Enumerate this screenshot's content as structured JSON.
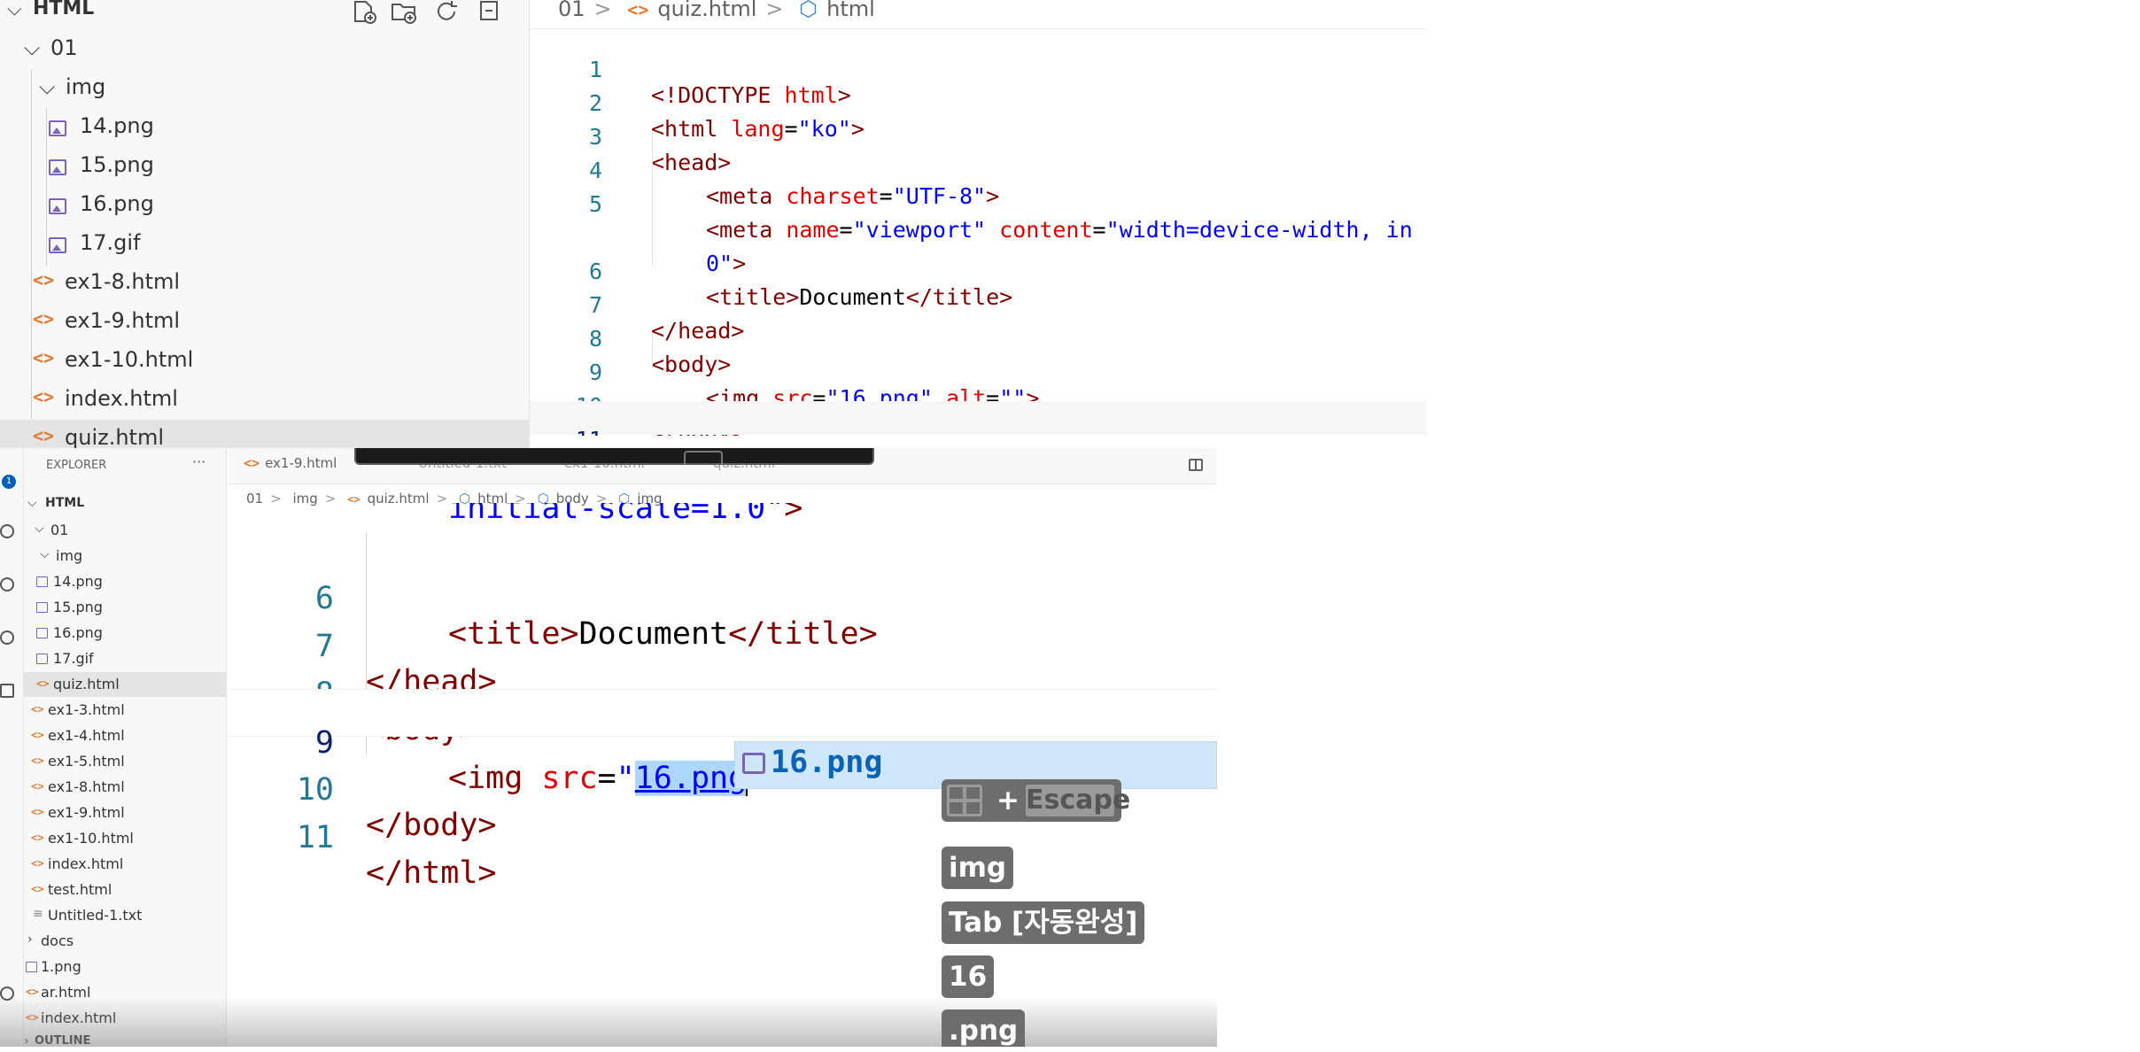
{
  "top_explorer": {
    "root_label": "HTML",
    "items": [
      {
        "label": "01",
        "type": "folder",
        "expanded": true
      },
      {
        "label": "img",
        "type": "folder",
        "expanded": true
      },
      {
        "label": "14.png",
        "type": "image"
      },
      {
        "label": "15.png",
        "type": "image"
      },
      {
        "label": "16.png",
        "type": "image"
      },
      {
        "label": "17.gif",
        "type": "image"
      },
      {
        "label": "ex1-8.html",
        "type": "html"
      },
      {
        "label": "ex1-9.html",
        "type": "html"
      },
      {
        "label": "ex1-10.html",
        "type": "html"
      },
      {
        "label": "index.html",
        "type": "html"
      },
      {
        "label": "quiz.html",
        "type": "html",
        "selected": true
      }
    ]
  },
  "top_editor": {
    "breadcrumb": [
      "01",
      "quiz.html",
      "html"
    ],
    "lines": [
      {
        "n": "1",
        "text": "<!DOCTYPE html>"
      },
      {
        "n": "2",
        "text": "<html lang=\"ko\">"
      },
      {
        "n": "3",
        "text": "<head>"
      },
      {
        "n": "4",
        "text": "<meta charset=\"UTF-8\">"
      },
      {
        "n": "5",
        "text": "<meta name=\"viewport\" content=\"width=device-width, in"
      },
      {
        "n": "",
        "text": "0\">"
      },
      {
        "n": "6",
        "text": "<title>Document</title>"
      },
      {
        "n": "7",
        "text": "</head>"
      },
      {
        "n": "8",
        "text": "<body>"
      },
      {
        "n": "9",
        "text": "<img src=\"16.png\" alt=\"\">"
      },
      {
        "n": "10",
        "text": "</body>"
      },
      {
        "n": "11",
        "text": "</html>"
      }
    ]
  },
  "bottom": {
    "explorer_title": "EXPLORER",
    "explorer_more": "···",
    "activity_badge": "1",
    "tree": [
      {
        "label": "HTML",
        "type": "root"
      },
      {
        "label": "01",
        "type": "folder"
      },
      {
        "label": "img",
        "type": "folder"
      },
      {
        "label": "14.png",
        "type": "image"
      },
      {
        "label": "15.png",
        "type": "image"
      },
      {
        "label": "16.png",
        "type": "image"
      },
      {
        "label": "17.gif",
        "type": "image"
      },
      {
        "label": "quiz.html",
        "type": "html",
        "selected": true
      },
      {
        "label": "ex1-3.html",
        "type": "html"
      },
      {
        "label": "ex1-4.html",
        "type": "html"
      },
      {
        "label": "ex1-5.html",
        "type": "html"
      },
      {
        "label": "ex1-8.html",
        "type": "html"
      },
      {
        "label": "ex1-9.html",
        "type": "html"
      },
      {
        "label": "ex1-10.html",
        "type": "html"
      },
      {
        "label": "index.html",
        "type": "html"
      },
      {
        "label": "test.html",
        "type": "html"
      },
      {
        "label": "Untitled-1.txt",
        "type": "text"
      },
      {
        "label": "docs",
        "type": "folder"
      },
      {
        "label": "1.png",
        "type": "image"
      },
      {
        "label": "ar.html",
        "type": "html"
      },
      {
        "label": "index.html",
        "type": "html"
      },
      {
        "label": "OUTLINE",
        "type": "section"
      }
    ],
    "tabs": [
      {
        "label": "ex1-9.html"
      },
      {
        "label": "Untitled-1.txt"
      },
      {
        "label": "ex1-10.html"
      },
      {
        "label": "quiz.html"
      }
    ],
    "breadcrumb": [
      "01",
      "img",
      "quiz.html",
      "html",
      "body",
      "img"
    ],
    "lines": [
      {
        "n": "",
        "text": "initial-scale=1.0\">"
      },
      {
        "n": "6",
        "text": "<title>Document</title>"
      },
      {
        "n": "7",
        "text": "</head>"
      },
      {
        "n": "8",
        "text": "<body>"
      },
      {
        "n": "9",
        "text": "<img src=\"16.png\" alt=\"\">"
      },
      {
        "n": "10",
        "text": "</body>"
      },
      {
        "n": "11",
        "text": "</html>"
      }
    ],
    "suggestion": "16.png"
  },
  "keys": {
    "combo_plus": "+",
    "combo_key": "Escape",
    "k1": "img",
    "k2": "Tab [자동완성]",
    "k3": "16",
    "k4": ".png"
  },
  "colors": {
    "tag": "#800000",
    "attribute": "#e50000",
    "string": "#0000ff",
    "selection": "#add6ff",
    "accent": "#005fb8"
  }
}
